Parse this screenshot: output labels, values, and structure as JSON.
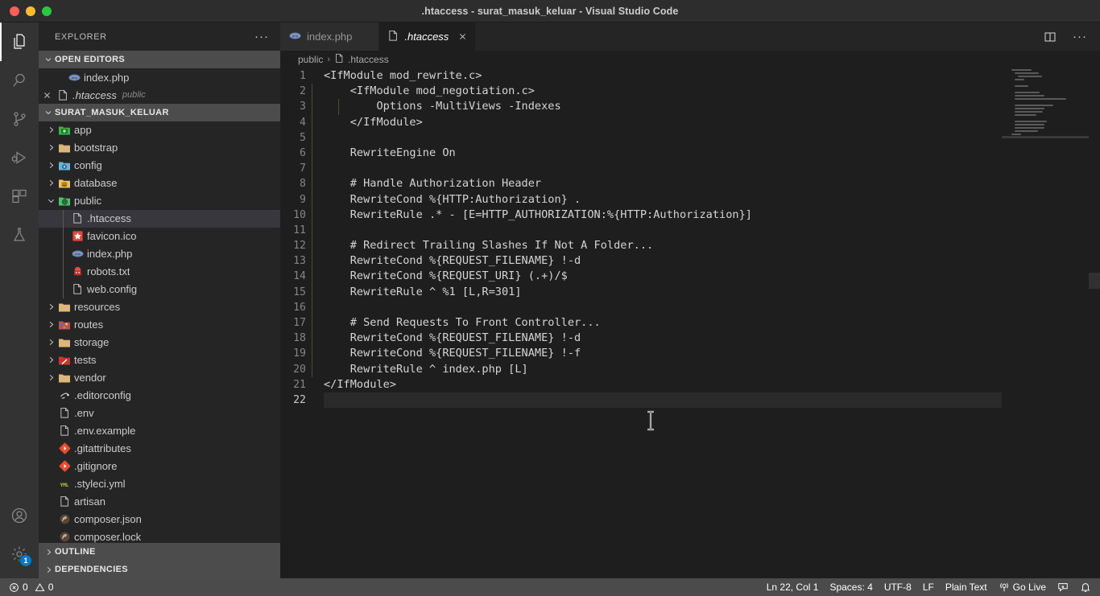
{
  "window": {
    "title": ".htaccess - surat_masuk_keluar - Visual Studio Code",
    "traffic_lights": [
      "close",
      "minimize",
      "zoom"
    ]
  },
  "activity_bar": {
    "items": [
      {
        "name": "explorer",
        "icon": "files-icon",
        "active": true
      },
      {
        "name": "search",
        "icon": "search-icon",
        "active": false
      },
      {
        "name": "source-control",
        "icon": "source-control-icon",
        "active": false
      },
      {
        "name": "run-debug",
        "icon": "run-and-debug-icon",
        "active": false
      },
      {
        "name": "extensions",
        "icon": "extensions-icon",
        "active": false
      },
      {
        "name": "testing",
        "icon": "beaker-icon",
        "active": false
      }
    ],
    "bottom_items": [
      {
        "name": "accounts",
        "icon": "account-icon",
        "badge": ""
      },
      {
        "name": "settings",
        "icon": "gear-icon",
        "badge": "1"
      }
    ]
  },
  "sidebar": {
    "title": "EXPLORER",
    "more_actions": "···",
    "open_editors": {
      "label": "OPEN EDITORS",
      "expanded": true,
      "items": [
        {
          "label": "index.php",
          "icon": "php-icon",
          "description": "",
          "selected": false,
          "italic": false,
          "show_close": false
        },
        {
          "label": ".htaccess",
          "icon": "file-icon",
          "description": "public",
          "selected": false,
          "italic": true,
          "show_close": true
        }
      ]
    },
    "workspace": {
      "label": "SURAT_MASUK_KELUAR",
      "expanded": true,
      "tree": [
        {
          "label": "app",
          "kind": "folder",
          "icon": "folder-app-icon",
          "expanded": false,
          "depth": 0,
          "selected": false
        },
        {
          "label": "bootstrap",
          "kind": "folder",
          "icon": "folder-icon",
          "expanded": false,
          "depth": 0,
          "selected": false
        },
        {
          "label": "config",
          "kind": "folder",
          "icon": "folder-config-icon",
          "expanded": false,
          "depth": 0,
          "selected": false
        },
        {
          "label": "database",
          "kind": "folder",
          "icon": "folder-database-icon",
          "expanded": false,
          "depth": 0,
          "selected": false
        },
        {
          "label": "public",
          "kind": "folder",
          "icon": "folder-public-icon",
          "expanded": true,
          "depth": 0,
          "selected": false
        },
        {
          "label": ".htaccess",
          "kind": "file",
          "icon": "file-icon",
          "depth": 1,
          "selected": true
        },
        {
          "label": "favicon.ico",
          "kind": "file",
          "icon": "favicon-icon",
          "depth": 1,
          "selected": false
        },
        {
          "label": "index.php",
          "kind": "file",
          "icon": "php-icon",
          "depth": 1,
          "selected": false
        },
        {
          "label": "robots.txt",
          "kind": "file",
          "icon": "robots-icon",
          "depth": 1,
          "selected": false
        },
        {
          "label": "web.config",
          "kind": "file",
          "icon": "file-icon",
          "depth": 1,
          "selected": false
        },
        {
          "label": "resources",
          "kind": "folder",
          "icon": "folder-icon",
          "expanded": false,
          "depth": 0,
          "selected": false
        },
        {
          "label": "routes",
          "kind": "folder",
          "icon": "folder-routes-icon",
          "expanded": false,
          "depth": 0,
          "selected": false
        },
        {
          "label": "storage",
          "kind": "folder",
          "icon": "folder-icon",
          "expanded": false,
          "depth": 0,
          "selected": false
        },
        {
          "label": "tests",
          "kind": "folder",
          "icon": "folder-tests-icon",
          "expanded": false,
          "depth": 0,
          "selected": false
        },
        {
          "label": "vendor",
          "kind": "folder",
          "icon": "folder-icon",
          "expanded": false,
          "depth": 0,
          "selected": false
        },
        {
          "label": ".editorconfig",
          "kind": "file",
          "icon": "editorconfig-icon",
          "depth": 0.5,
          "selected": false
        },
        {
          "label": ".env",
          "kind": "file",
          "icon": "file-icon",
          "depth": 0.5,
          "selected": false
        },
        {
          "label": ".env.example",
          "kind": "file",
          "icon": "file-icon",
          "depth": 0.5,
          "selected": false
        },
        {
          "label": ".gitattributes",
          "kind": "file",
          "icon": "git-icon",
          "depth": 0.5,
          "selected": false
        },
        {
          "label": ".gitignore",
          "kind": "file",
          "icon": "git-icon",
          "depth": 0.5,
          "selected": false
        },
        {
          "label": ".styleci.yml",
          "kind": "file",
          "icon": "yml-icon",
          "depth": 0.5,
          "selected": false
        },
        {
          "label": "artisan",
          "kind": "file",
          "icon": "file-icon",
          "depth": 0.5,
          "selected": false
        },
        {
          "label": "composer.json",
          "kind": "file",
          "icon": "composer-icon",
          "depth": 0.5,
          "selected": false
        },
        {
          "label": "composer.lock",
          "kind": "file",
          "icon": "composer-icon",
          "depth": 0.5,
          "selected": false
        }
      ]
    },
    "outline": {
      "label": "OUTLINE",
      "expanded": false
    },
    "dependencies": {
      "label": "DEPENDENCIES",
      "expanded": false
    }
  },
  "editor": {
    "tabs": [
      {
        "label": "index.php",
        "icon": "php-icon",
        "active": false,
        "preview": false,
        "show_close": false
      },
      {
        "label": ".htaccess",
        "icon": "file-icon",
        "active": true,
        "preview": true,
        "show_close": true
      }
    ],
    "tab_actions": [
      {
        "name": "split-editor-right",
        "icon": "split-editor-icon"
      },
      {
        "name": "more-actions",
        "icon": "ellipsis-icon",
        "label": "···"
      }
    ],
    "breadcrumbs": [
      {
        "label": "public",
        "icon": ""
      },
      {
        "label": ".htaccess",
        "icon": "file-icon"
      }
    ],
    "language": "Plain Text",
    "current_line": 22,
    "lines": [
      {
        "n": "1",
        "text": "<IfModule mod_rewrite.c>"
      },
      {
        "n": "2",
        "text": "    <IfModule mod_negotiation.c>"
      },
      {
        "n": "3",
        "text": "        Options -MultiViews -Indexes"
      },
      {
        "n": "4",
        "text": "    </IfModule>"
      },
      {
        "n": "5",
        "text": ""
      },
      {
        "n": "6",
        "text": "    RewriteEngine On"
      },
      {
        "n": "7",
        "text": ""
      },
      {
        "n": "8",
        "text": "    # Handle Authorization Header"
      },
      {
        "n": "9",
        "text": "    RewriteCond %{HTTP:Authorization} ."
      },
      {
        "n": "10",
        "text": "    RewriteRule .* - [E=HTTP_AUTHORIZATION:%{HTTP:Authorization}]"
      },
      {
        "n": "11",
        "text": ""
      },
      {
        "n": "12",
        "text": "    # Redirect Trailing Slashes If Not A Folder..."
      },
      {
        "n": "13",
        "text": "    RewriteCond %{REQUEST_FILENAME} !-d"
      },
      {
        "n": "14",
        "text": "    RewriteCond %{REQUEST_URI} (.+)/$"
      },
      {
        "n": "15",
        "text": "    RewriteRule ^ %1 [L,R=301]"
      },
      {
        "n": "16",
        "text": ""
      },
      {
        "n": "17",
        "text": "    # Send Requests To Front Controller..."
      },
      {
        "n": "18",
        "text": "    RewriteCond %{REQUEST_FILENAME} !-d"
      },
      {
        "n": "19",
        "text": "    RewriteCond %{REQUEST_FILENAME} !-f"
      },
      {
        "n": "20",
        "text": "    RewriteRule ^ index.php [L]"
      },
      {
        "n": "21",
        "text": "</IfModule>"
      },
      {
        "n": "22",
        "text": ""
      }
    ]
  },
  "status_bar": {
    "left": [
      {
        "name": "problems",
        "icon": "error-icon",
        "label": "0",
        "icon2": "warning-icon",
        "label2": "0"
      }
    ],
    "right": [
      {
        "name": "cursor-position",
        "label": "Ln 22, Col 1"
      },
      {
        "name": "indentation",
        "label": "Spaces: 4"
      },
      {
        "name": "encoding",
        "label": "UTF-8"
      },
      {
        "name": "eol",
        "label": "LF"
      },
      {
        "name": "language-mode",
        "label": "Plain Text"
      },
      {
        "name": "go-live",
        "label": "Go Live",
        "icon": "broadcast-icon"
      },
      {
        "name": "feedback",
        "label": "",
        "icon": "feedback-icon"
      },
      {
        "name": "notifications",
        "label": "",
        "icon": "bell-icon"
      }
    ]
  },
  "colors": {
    "titlebar_bg": "#2d2d2d",
    "activitybar_bg": "#333333",
    "sidebar_bg": "#252526",
    "editor_bg": "#1e1e1e",
    "statusbar_bg": "#4b4b4b",
    "accent": "#007acc",
    "selection": "#37373d",
    "text": "#cccccc",
    "code_text": "#d4d4d4",
    "line_number": "#858585"
  }
}
